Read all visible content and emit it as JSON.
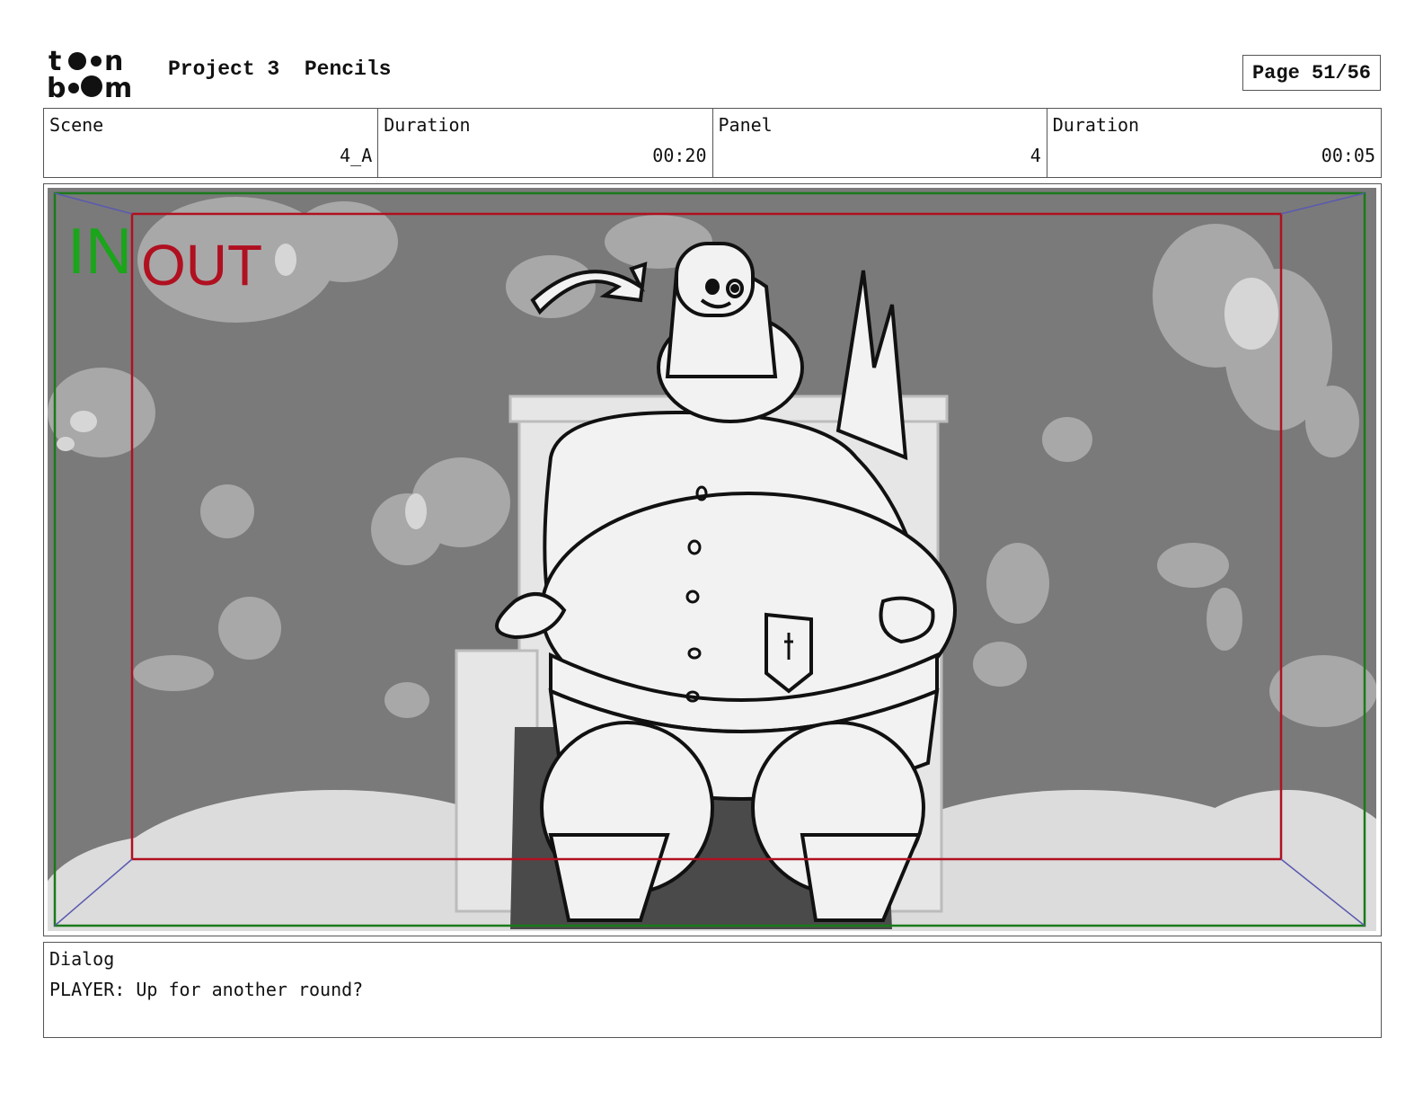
{
  "header": {
    "logo_text": "toon boom",
    "project": "Project 3",
    "stage": "Pencils",
    "page_label": "Page 51/56"
  },
  "info": {
    "scene_label": "Scene",
    "scene_value": "4_A",
    "scene_duration_label": "Duration",
    "scene_duration_value": "00:20",
    "panel_label": "Panel",
    "panel_value": "4",
    "panel_duration_label": "Duration",
    "panel_duration_value": "00:05"
  },
  "panel": {
    "overlay_in": "IN",
    "overlay_out": "OUT",
    "colors": {
      "in": "#1aa51a",
      "out": "#b01020",
      "safe_frame": "#b01020",
      "outer_frame": "#1a7a1a"
    }
  },
  "dialog": {
    "label": "Dialog",
    "text": "PLAYER: Up for another round?"
  }
}
